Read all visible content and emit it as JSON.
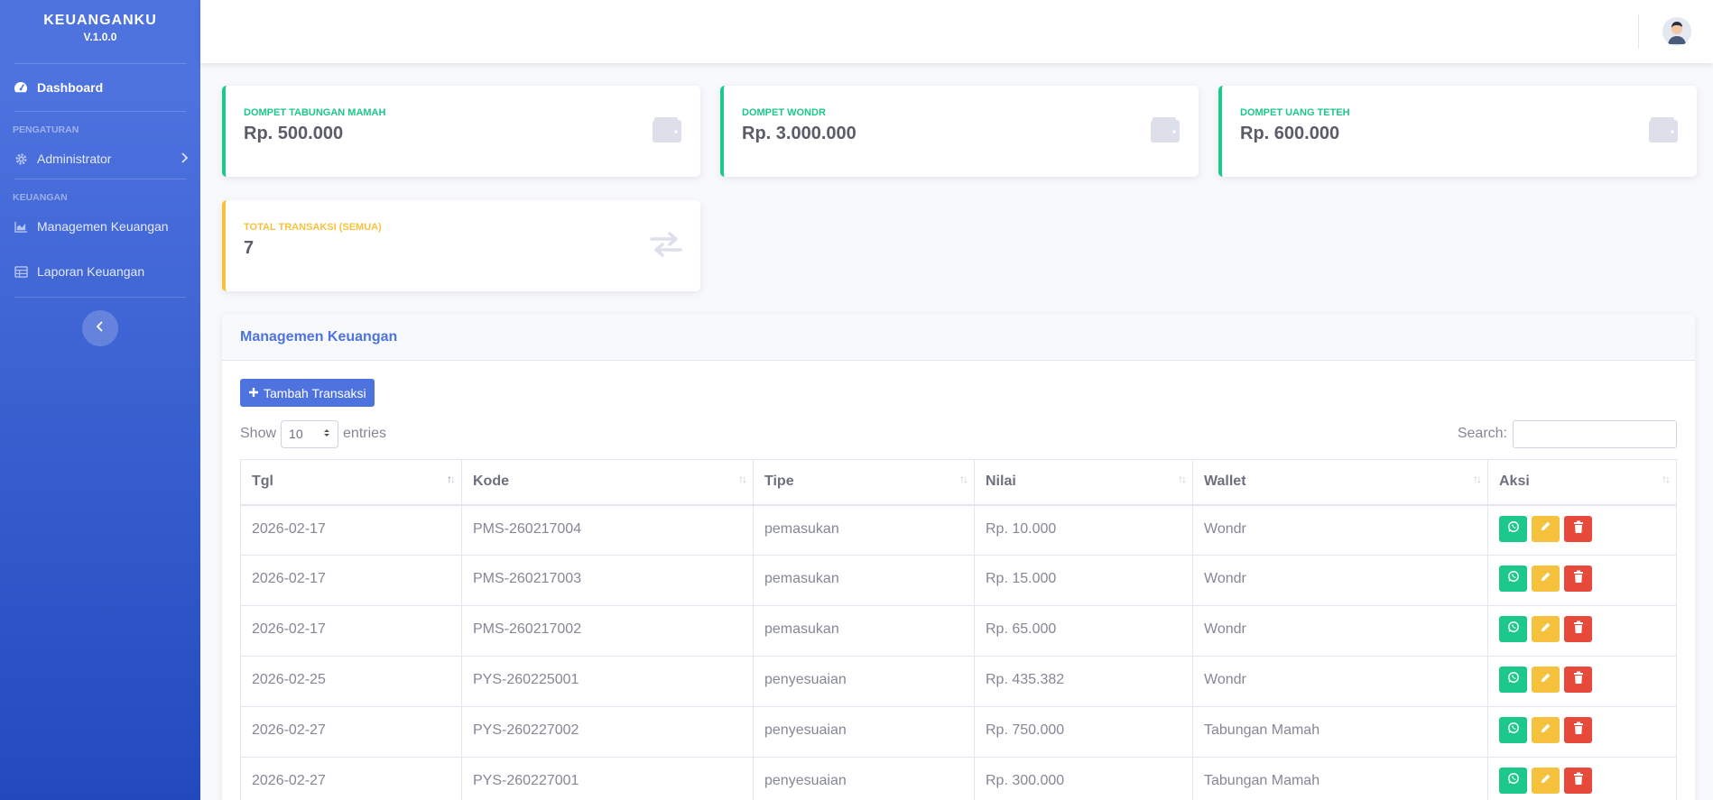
{
  "sidebar": {
    "brand_title": "KEUANGANKU",
    "brand_version": "V.1.0.0",
    "dashboard_label": "Dashboard",
    "heading_pengaturan": "PENGATURAN",
    "administrator_label": "Administrator",
    "heading_keuangan": "KEUANGAN",
    "managemen_label": "Managemen Keuangan",
    "laporan_label": "Laporan Keuangan"
  },
  "stats": [
    {
      "label": "DOMPET TABUNGAN MAMAH",
      "value": "Rp. 500.000",
      "icon": "wallet-icon"
    },
    {
      "label": "DOMPET WONDR",
      "value": "Rp. 3.000.000",
      "icon": "wallet-icon"
    },
    {
      "label": "DOMPET UANG TETEH",
      "value": "Rp. 600.000",
      "icon": "wallet-icon"
    },
    {
      "label": "TOTAL TRANSAKSI (SEMUA)",
      "value": "7",
      "icon": "exchange-icon"
    }
  ],
  "table_card": {
    "title": "Managemen Keuangan",
    "add_button": "Tambah Transaksi",
    "show_label": "Show",
    "entries_value": "10",
    "entries_label": "entries",
    "search_label": "Search:",
    "search_value": "",
    "columns": [
      "Tgl",
      "Kode",
      "Tipe",
      "Nilai",
      "Wallet",
      "Aksi"
    ],
    "rows": [
      {
        "tgl": "2026-02-17",
        "kode": "PMS-260217004",
        "tipe": "pemasukan",
        "nilai": "Rp. 10.000",
        "wallet": "Wondr"
      },
      {
        "tgl": "2026-02-17",
        "kode": "PMS-260217003",
        "tipe": "pemasukan",
        "nilai": "Rp. 15.000",
        "wallet": "Wondr"
      },
      {
        "tgl": "2026-02-17",
        "kode": "PMS-260217002",
        "tipe": "pemasukan",
        "nilai": "Rp. 65.000",
        "wallet": "Wondr"
      },
      {
        "tgl": "2026-02-25",
        "kode": "PYS-260225001",
        "tipe": "penyesuaian",
        "nilai": "Rp. 435.382",
        "wallet": "Wondr"
      },
      {
        "tgl": "2026-02-27",
        "kode": "PYS-260227002",
        "tipe": "penyesuaian",
        "nilai": "Rp. 750.000",
        "wallet": "Tabungan Mamah"
      },
      {
        "tgl": "2026-02-27",
        "kode": "PYS-260227001",
        "tipe": "penyesuaian",
        "nilai": "Rp. 300.000",
        "wallet": "Tabungan Mamah"
      }
    ]
  },
  "colors": {
    "primary": "#4e73df",
    "success": "#1cc88a",
    "warning": "#f6c23e",
    "danger": "#e74a3b"
  }
}
